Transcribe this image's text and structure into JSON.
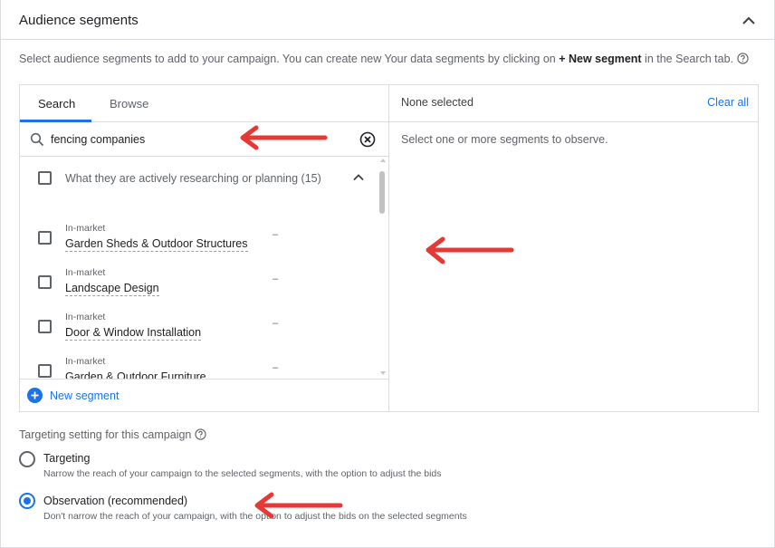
{
  "section": {
    "title": "Audience segments",
    "collapse_icon": "chevron-up-icon"
  },
  "intro": {
    "prefix": "Select audience segments to add to your campaign. You can create new Your data segments by clicking on ",
    "bold": "+ New segment",
    "suffix": " in the Search tab."
  },
  "tabs": [
    {
      "label": "Search",
      "active": true
    },
    {
      "label": "Browse",
      "active": false
    }
  ],
  "search": {
    "value": "fencing companies",
    "placeholder": ""
  },
  "results": {
    "group_label": "What they are actively researching or planning (15)",
    "items": [
      {
        "type": "In-market",
        "name": "Garden Sheds & Outdoor Structures",
        "reach": "–"
      },
      {
        "type": "In-market",
        "name": "Landscape Design",
        "reach": "–"
      },
      {
        "type": "In-market",
        "name": "Door & Window Installation",
        "reach": "–"
      },
      {
        "type": "In-market",
        "name": "Garden & Outdoor Furniture",
        "reach": "–"
      }
    ]
  },
  "new_segment_label": "New segment",
  "selected": {
    "header": "None selected",
    "clear_all": "Clear all",
    "hint": "Select one or more segments to observe."
  },
  "targeting": {
    "title": "Targeting setting for this campaign",
    "options": [
      {
        "label": "Targeting",
        "description": "Narrow the reach of your campaign to the selected segments, with the option to adjust the bids",
        "selected": false
      },
      {
        "label": "Observation (recommended)",
        "description": "Don't narrow the reach of your campaign, with the option to adjust the bids on the selected segments",
        "selected": true
      }
    ]
  },
  "colors": {
    "accent": "#1a73e8",
    "annotation_arrow": "#e53935"
  }
}
